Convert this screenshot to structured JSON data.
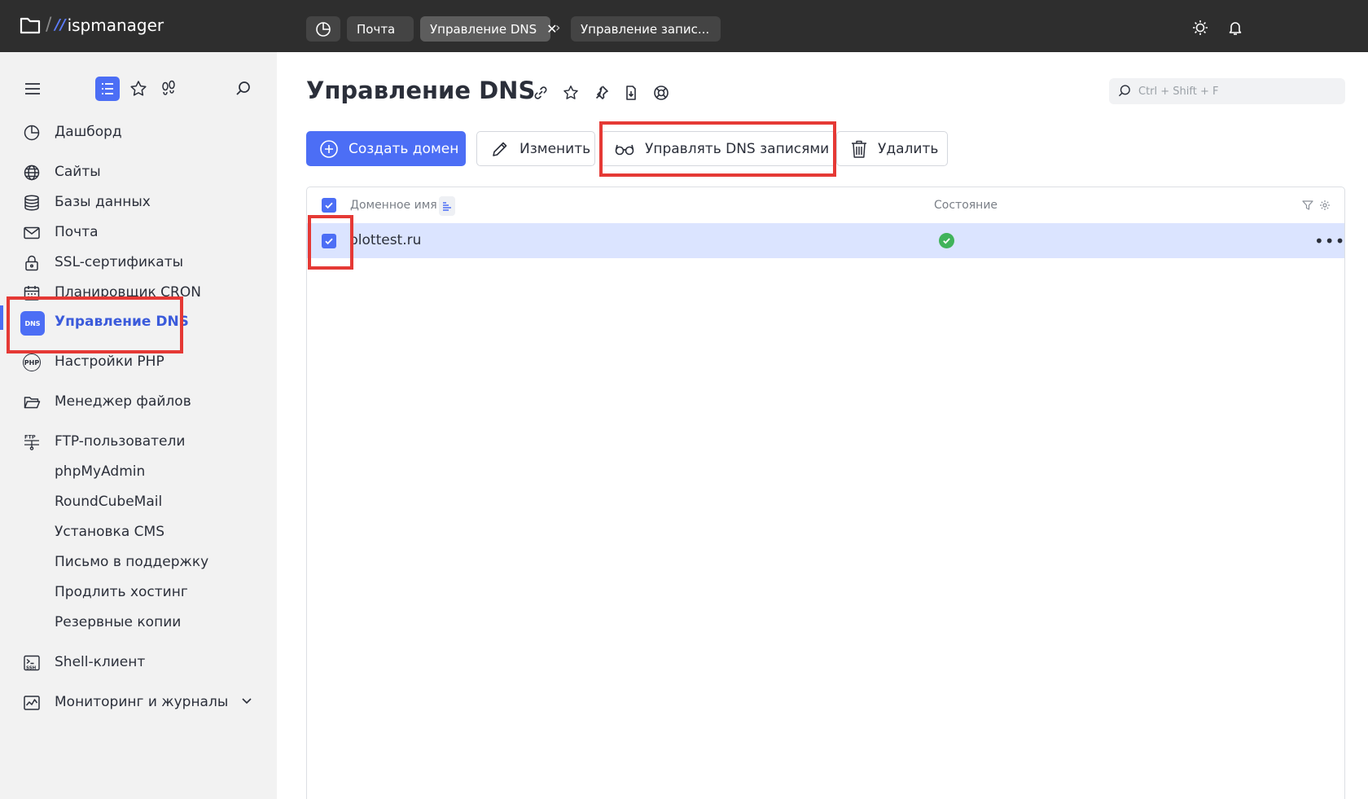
{
  "app": {
    "logo_sep": "/",
    "logo_mark": "//",
    "logo_text": "ispmanager"
  },
  "tabs": [
    {
      "label": "Почта"
    },
    {
      "label": "Управление DNS"
    },
    {
      "label": "Управление запис..."
    }
  ],
  "sidebar": {
    "items": [
      {
        "label": "Дашборд",
        "icon": "dashboard-icon"
      },
      {
        "label": "Сайты",
        "icon": "globe-icon"
      },
      {
        "label": "Базы данных",
        "icon": "database-icon"
      },
      {
        "label": "Почта",
        "icon": "mail-icon"
      },
      {
        "label": "SSL-сертификаты",
        "icon": "lock-icon"
      },
      {
        "label": "Планировщик CRON",
        "icon": "calendar-icon"
      },
      {
        "label": "Управление DNS",
        "icon": "dns-icon",
        "badge": "DNS"
      },
      {
        "label": "Настройки PHP",
        "icon": "php-icon",
        "badge": "PHP"
      },
      {
        "label": "Менеджер файлов",
        "icon": "folder-icon"
      },
      {
        "label": "FTP-пользователи",
        "icon": "ftp-icon"
      },
      {
        "label": "phpMyAdmin"
      },
      {
        "label": "RoundCubeMail"
      },
      {
        "label": "Установка CMS"
      },
      {
        "label": "Письмо в поддержку"
      },
      {
        "label": "Продлить хостинг"
      },
      {
        "label": "Резервные копии"
      },
      {
        "label": "Shell-клиент",
        "icon": "terminal-icon"
      },
      {
        "label": "Мониторинг и журналы",
        "icon": "chart-icon"
      }
    ]
  },
  "main": {
    "title": "Управление DNS",
    "search_placeholder": "Ctrl + Shift + F",
    "toolbar": {
      "create": "Создать домен",
      "edit": "Изменить",
      "manage_records": "Управлять DNS записями",
      "delete": "Удалить"
    },
    "table": {
      "columns": [
        "Доменное имя",
        "Состояние"
      ],
      "rows": [
        {
          "domain": "blottest.ru",
          "status": "ok",
          "selected": true
        }
      ]
    }
  },
  "colors": {
    "accent": "#4c6ef5",
    "topbar": "#2e2e2e",
    "sidebar": "#f2f2f2",
    "selected_row": "#dbe4ff",
    "status_ok": "#40b35a",
    "annotation": "#e53935"
  }
}
